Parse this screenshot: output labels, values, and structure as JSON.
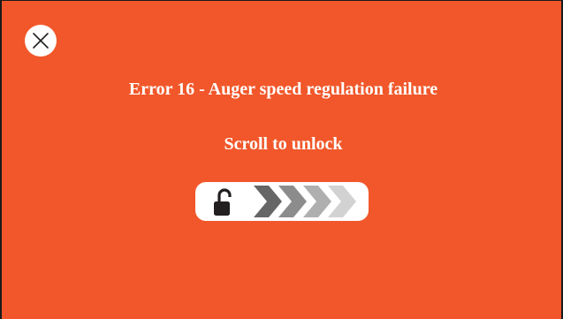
{
  "dialog": {
    "title": "Error 16 - Auger speed regulation failure",
    "unlock_label": "Scroll to unlock"
  },
  "icons": {
    "close": "close-icon",
    "lock": "lock-open-icon",
    "chevrons": "chevron-right-icon"
  },
  "colors": {
    "background": "#f1572a",
    "text": "#ffffff",
    "slider": "#ffffff",
    "lock": "#231f20",
    "chevron_1": "#666666",
    "chevron_2": "#8c8c8c",
    "chevron_3": "#afafaf",
    "chevron_4": "#d2d2d2"
  }
}
